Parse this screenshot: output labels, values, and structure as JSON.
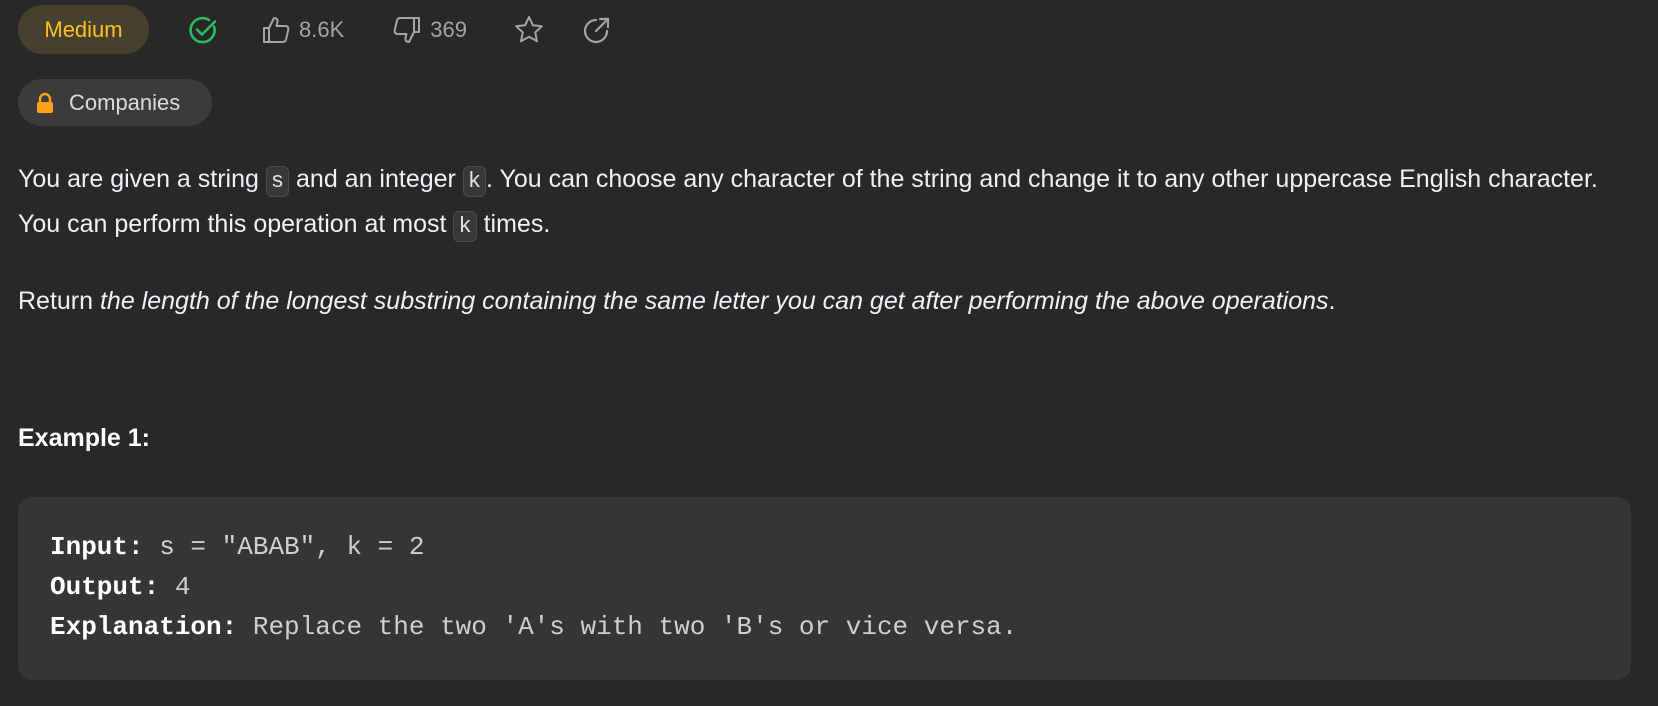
{
  "header": {
    "difficulty": "Medium",
    "likes": "8.6K",
    "dislikes": "369"
  },
  "companies": {
    "label": "Companies"
  },
  "description": {
    "p1_a": "You are given a string ",
    "p1_code1": "s",
    "p1_b": " and an integer ",
    "p1_code2": "k",
    "p1_c": ". You can choose any character of the string and change it to any other uppercase English character. You can perform this operation at most ",
    "p1_code3": "k",
    "p1_d": " times.",
    "p2_a": "Return ",
    "p2_em": "the length of the longest substring containing the same letter you can get after performing the above operations",
    "p2_b": "."
  },
  "example1": {
    "title": "Example 1:",
    "input_label": "Input:",
    "input_value": " s = \"ABAB\", k = 2",
    "output_label": "Output:",
    "output_value": " 4",
    "explanation_label": "Explanation:",
    "explanation_value": " Replace the two 'A's with two 'B's or vice versa."
  },
  "colors": {
    "background": "#282828",
    "difficulty_medium": "#ffc01e",
    "solved_green": "#2cbb5d",
    "lock_orange": "#ffa116"
  },
  "icons": [
    "check-circle-icon",
    "thumbs-up-icon",
    "thumbs-down-icon",
    "star-icon",
    "share-icon",
    "lock-icon"
  ]
}
